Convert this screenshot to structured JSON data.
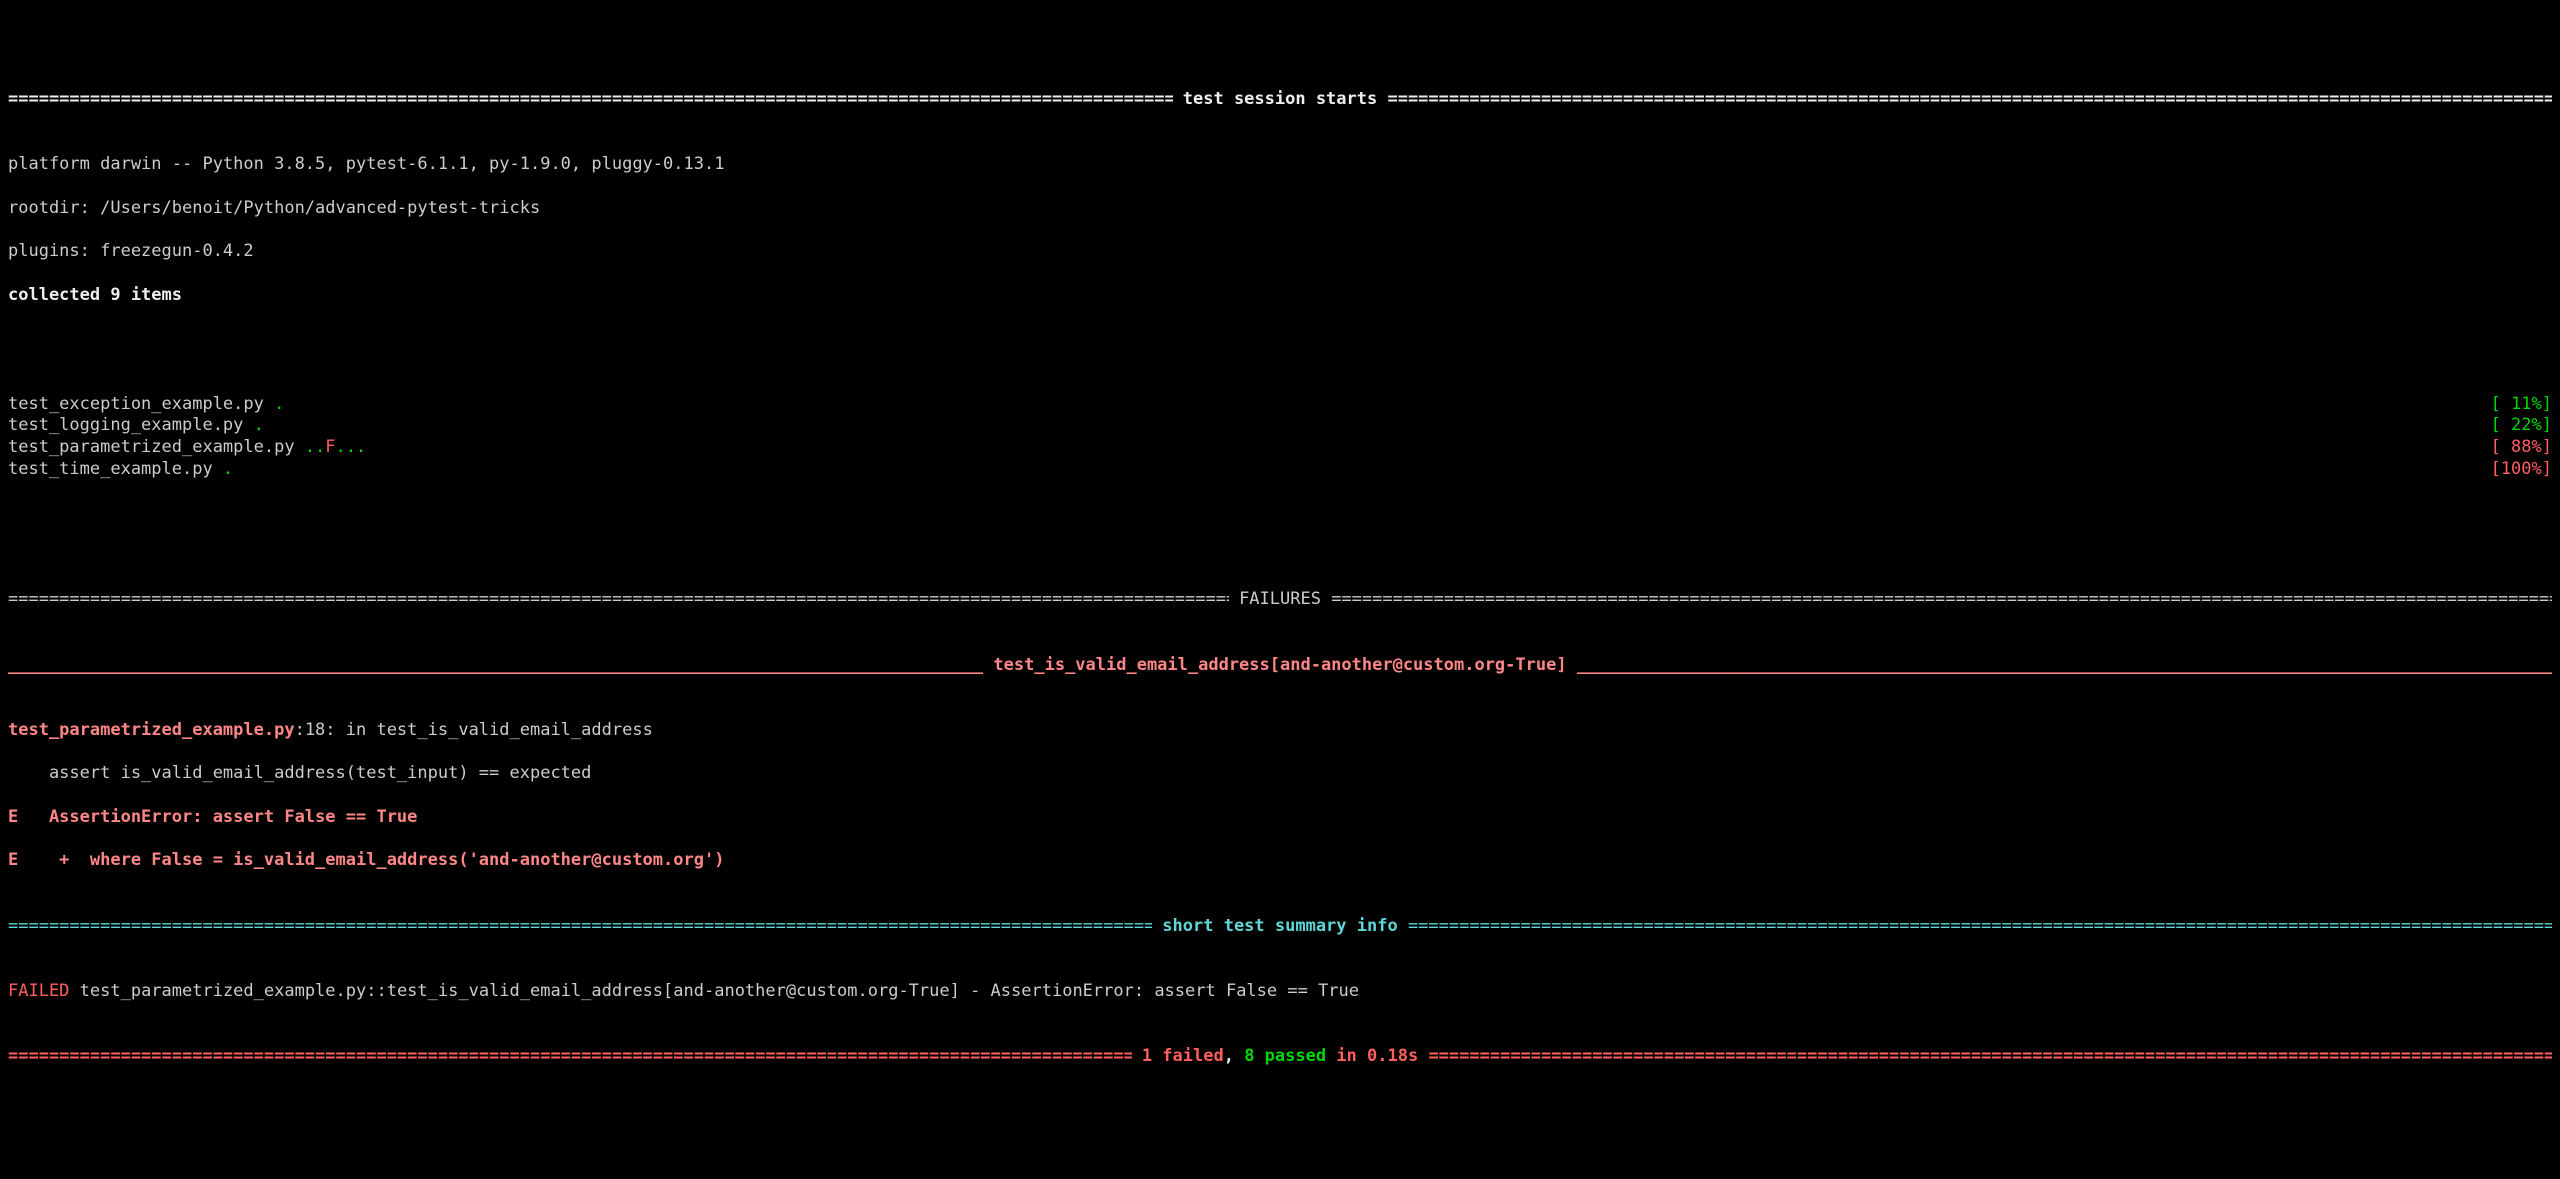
{
  "session_header": {
    "title": " test session starts "
  },
  "env": {
    "platform_line": "platform darwin -- Python 3.8.5, pytest-6.1.1, py-1.9.0, pluggy-0.13.1",
    "rootdir_line": "rootdir: /Users/benoit/Python/advanced-pytest-tricks",
    "plugins_line": "plugins: freezegun-0.4.2",
    "collected_line": "collected 9 items"
  },
  "results": [
    {
      "file": "test_exception_example.py ",
      "dots": ".",
      "dots_html": "<span class='dot-green'>.</span>",
      "pct": "[ 11%]",
      "pct_class": "green"
    },
    {
      "file": "test_logging_example.py ",
      "dots": ".",
      "dots_html": "<span class='dot-green'>.</span>",
      "pct": "[ 22%]",
      "pct_class": "green"
    },
    {
      "file": "test_parametrized_example.py ",
      "dots": "..F...",
      "dots_html": "<span class='dot-green'>..</span><span class='dot-red'>F</span><span class='dot-green'>...</span>",
      "pct": "[ 88%]",
      "pct_class": "red"
    },
    {
      "file": "test_time_example.py ",
      "dots": ".",
      "dots_html": "<span class='dot-green'>.</span>",
      "pct": "[100%]",
      "pct_class": "red"
    }
  ],
  "failures": {
    "header": " FAILURES ",
    "test_name": " test_is_valid_email_address[and-another@custom.org-True] ",
    "location_file": "test_parametrized_example.py",
    "location_rest": ":18: in test_is_valid_email_address",
    "assert_line": "    assert is_valid_email_address(test_input) == expected",
    "error_line1": "E   AssertionError: assert False == True",
    "error_line2": "E    +  where False = is_valid_email_address('and-another@custom.org')"
  },
  "summary": {
    "short_header": " short test summary info ",
    "failed_line_prefix": "FAILED test_parametrized_example.py::test_is_valid_email_address[and-another@custom.org-True] - AssertionError: assert False == True",
    "final_failed": " 1 failed",
    "final_sep": ", ",
    "final_passed": "8 passed",
    "final_in": " in 0.18s "
  }
}
